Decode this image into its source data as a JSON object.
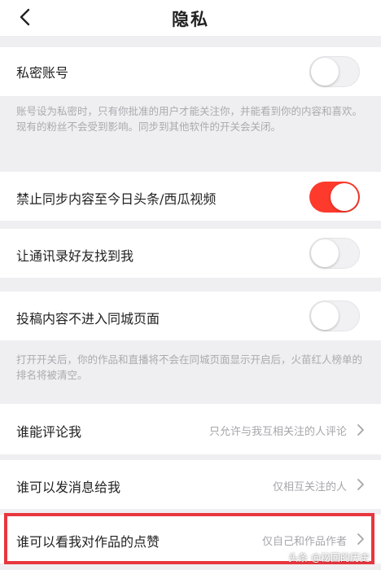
{
  "header": {
    "title": "隐私",
    "back_icon": "chevron-left-icon"
  },
  "private_account": {
    "label": "私密账号",
    "enabled": false,
    "description": "账号设为私密时，只有你批准的用户才能关注你，并能看到你的内容和喜欢。现有的粉丝不会受到影响。同步到其他软件的开关会关闭。"
  },
  "sync_block": {
    "label": "禁止同步内容至今日头条/西瓜视频",
    "enabled": true
  },
  "contacts": {
    "label": "让通讯录好友找到我",
    "enabled": false
  },
  "local_page": {
    "label": "投稿内容不进入同城页面",
    "enabled": false,
    "description": "打开开关后，你的作品和直播将不会在同城页面显示开启后，火苗红人榜单的排名将被清空。"
  },
  "comment": {
    "label": "谁能评论我",
    "value": "只允许与我互相关注的人评论"
  },
  "message": {
    "label": "谁可以发消息给我",
    "value": "仅相互关注的人"
  },
  "likes_visibility": {
    "label": "谁可以看我对作品的点赞",
    "value": "仅自己和作品作者"
  },
  "watermark": "头条 @秘回的历史",
  "colors": {
    "accent": "#fd3a2c",
    "highlight_border": "#e8363f",
    "background": "#efeff1"
  }
}
